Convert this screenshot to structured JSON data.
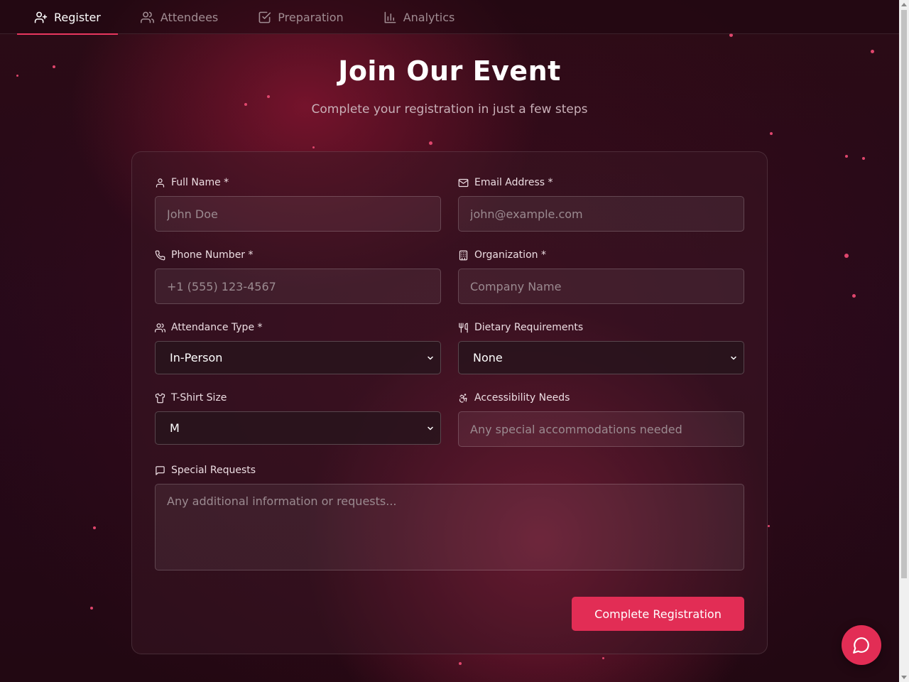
{
  "nav": {
    "tabs": [
      {
        "label": "Register",
        "icon": "user-plus-icon",
        "active": true
      },
      {
        "label": "Attendees",
        "icon": "users-icon",
        "active": false
      },
      {
        "label": "Preparation",
        "icon": "check-square-icon",
        "active": false
      },
      {
        "label": "Analytics",
        "icon": "bar-chart-icon",
        "active": false
      }
    ]
  },
  "header": {
    "title": "Join Our Event",
    "subtitle": "Complete your registration in just a few steps"
  },
  "form": {
    "full_name": {
      "label": "Full Name *",
      "placeholder": "John Doe",
      "icon": "user-icon"
    },
    "email": {
      "label": "Email Address *",
      "placeholder": "john@example.com",
      "icon": "mail-icon"
    },
    "phone": {
      "label": "Phone Number *",
      "placeholder": "+1 (555) 123-4567",
      "icon": "phone-icon"
    },
    "organization": {
      "label": "Organization *",
      "placeholder": "Company Name",
      "icon": "building-icon"
    },
    "attendance_type": {
      "label": "Attendance Type *",
      "value": "In-Person",
      "icon": "users-icon"
    },
    "dietary": {
      "label": "Dietary Requirements",
      "value": "None",
      "icon": "utensils-icon"
    },
    "tshirt": {
      "label": "T-Shirt Size",
      "value": "M",
      "icon": "shirt-icon"
    },
    "accessibility": {
      "label": "Accessibility Needs",
      "placeholder": "Any special accommodations needed",
      "icon": "accessibility-icon"
    },
    "special_requests": {
      "label": "Special Requests",
      "placeholder": "Any additional information or requests...",
      "icon": "message-square-icon"
    },
    "submit_label": "Complete Registration"
  },
  "chat_button": {
    "icon": "chat-bubble-icon"
  },
  "colors": {
    "accent": "#e22d55",
    "background": "#2a0d16",
    "text": "#ffffff"
  }
}
